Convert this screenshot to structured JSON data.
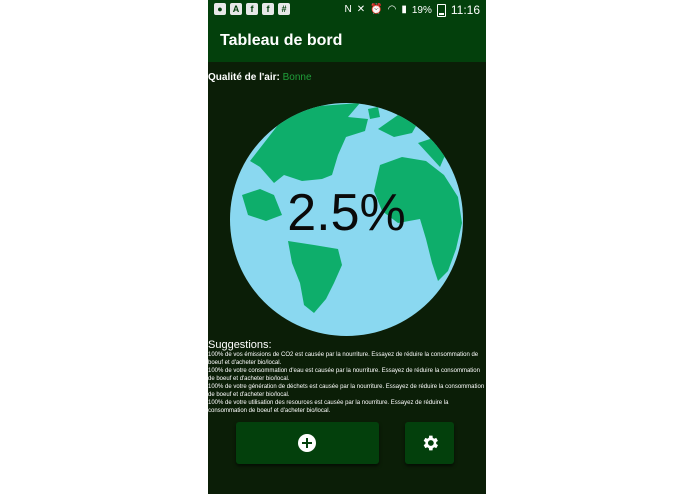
{
  "status_bar": {
    "battery": "19%",
    "time": "11:16",
    "left_icons": [
      "notification-icon",
      "a-app-icon",
      "facebook-icon",
      "facebook-icon",
      "slack-icon"
    ]
  },
  "app_bar": {
    "title": "Tableau de bord"
  },
  "air_quality": {
    "label": "Qualité de l'air:",
    "value": "Bonne",
    "value_color": "#1f9e3a"
  },
  "globe": {
    "percent": "2.5%",
    "ocean_color": "#8ad8f0",
    "land_color": "#0eae6b"
  },
  "suggestions": {
    "title": "Suggestions:",
    "items": [
      "100% de vos émissions de CO2 est causée par la nourriture. Essayez de réduire la consommation de boeuf et d'acheter bio/local.",
      "100% de votre consommation d'eau est causée par la nourriture. Essayez de réduire la consommation de boeuf et d'acheter bio/local.",
      "100% de votre génération de déchets est causée par la nourriture. Essayez de réduire la consommation de boeuf et d'acheter bio/local.",
      "100% de votre utilisation des resources est causée par la nourriture. Essayez de réduire la consommation de boeuf et d'acheter bio/local."
    ]
  },
  "buttons": {
    "add_icon": "plus-circle-icon",
    "settings_icon": "gear-icon"
  },
  "colors": {
    "background": "#0b1e07",
    "bar": "#03400c",
    "text": "#ffffff"
  }
}
